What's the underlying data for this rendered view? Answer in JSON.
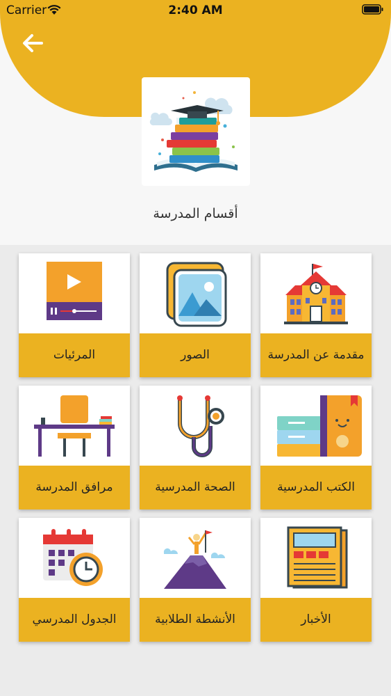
{
  "status_bar": {
    "carrier": "Carrier",
    "time": "2:40 AM"
  },
  "header": {
    "back_icon": "arrow-left-icon",
    "logo_icon": "books-graduation-cap-logo",
    "title": "أقسام المدرسة"
  },
  "colors": {
    "accent": "#ebb221",
    "background": "#ebebeb",
    "top_area": "#f7f7f7"
  },
  "sections": [
    {
      "label": "مقدمة عن المدرسة",
      "icon": "school-building-icon"
    },
    {
      "label": "الصور",
      "icon": "photo-gallery-icon"
    },
    {
      "label": "المرئيات",
      "icon": "video-player-icon"
    },
    {
      "label": "الكتب المدرسية",
      "icon": "books-icon"
    },
    {
      "label": "الصحة المدرسية",
      "icon": "stethoscope-icon"
    },
    {
      "label": "مرافق المدرسة",
      "icon": "desk-chair-icon"
    },
    {
      "label": "الأخبار",
      "icon": "newspaper-icon"
    },
    {
      "label": "الأنشطة الطلابية",
      "icon": "mountain-flag-icon"
    },
    {
      "label": "الجدول المدرسي",
      "icon": "calendar-clock-icon"
    }
  ]
}
